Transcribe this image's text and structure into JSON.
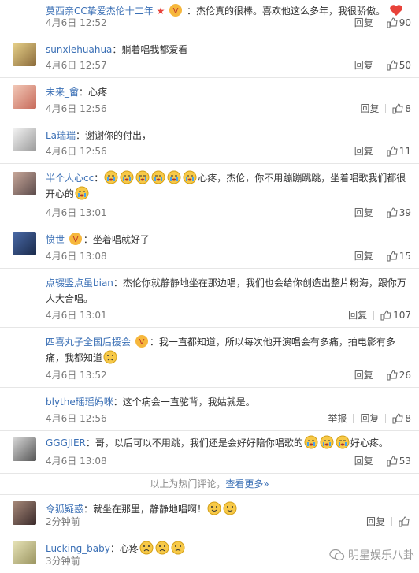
{
  "labels": {
    "reply": "回复",
    "report": "举报"
  },
  "comments": [
    {
      "user": "莫西亲CC挚爱杰伦十二年",
      "text": "：杰伦真的很棒。喜欢他这么多年，我很骄傲。",
      "time": "4月6日 12:52",
      "likes": "90"
    },
    {
      "user": "sunxiehuahua",
      "text": "：躺着唱我都爱看",
      "time": "4月6日 12:57",
      "likes": "50"
    },
    {
      "user": "未来_畲",
      "text": "：心疼",
      "time": "4月6日 12:56",
      "likes": "8"
    },
    {
      "user": "La瑞瑞",
      "text": "：谢谢你的付出，",
      "time": "4月6日 12:56",
      "likes": "11"
    },
    {
      "user": "半个人心cc",
      "text_a": "：",
      "text_b": "心疼，杰伦，你不用蹦蹦跳跳，坐着唱歌我们都很开心的",
      "time": "4月6日 13:01",
      "likes": "39"
    },
    {
      "user": "愤世",
      "text": "：坐着唱就好了",
      "time": "4月6日 13:08",
      "likes": "15"
    },
    {
      "user": "点辍竖点虽bian",
      "text": "：杰伦你就静静地坐在那边唱，我们也会给你创造出整片粉海，跟你万人大合唱。",
      "time": "4月6日 13:01",
      "likes": "107"
    },
    {
      "user": "四喜丸子全国后援会",
      "text": "：我一直都知道，所以每次他开演唱会有多痛，拍电影有多痛，我都知道",
      "time": "4月6日 13:52",
      "likes": "26"
    },
    {
      "user": "blythe瑶瑶妈咪",
      "text": "：这个病会一直驼背，我姑就是。",
      "time": "4月6日 12:56",
      "likes": "8"
    },
    {
      "user": "GGGJIER",
      "text_a": "：哥，以后可以不用跳，我们还是会好好陪你唱歌的",
      "text_b": "好心疼。",
      "time": "4月6日 13:08",
      "likes": "53"
    },
    {
      "user": "令狐疑惑",
      "text": "：就坐在那里，静静地唱啊！",
      "time": "2分钟前",
      "likes": ""
    },
    {
      "user": "Lucking_baby",
      "text": "：心疼",
      "time": "3分钟前",
      "likes": ""
    }
  ],
  "hot_divider": {
    "text": "以上为热门评论，",
    "more": "查看更多»"
  },
  "watermark": "明星娱乐八卦",
  "colors": {
    "username": "#3a6fb5",
    "heart": "#e8423a",
    "meta": "#7a7a7a"
  }
}
